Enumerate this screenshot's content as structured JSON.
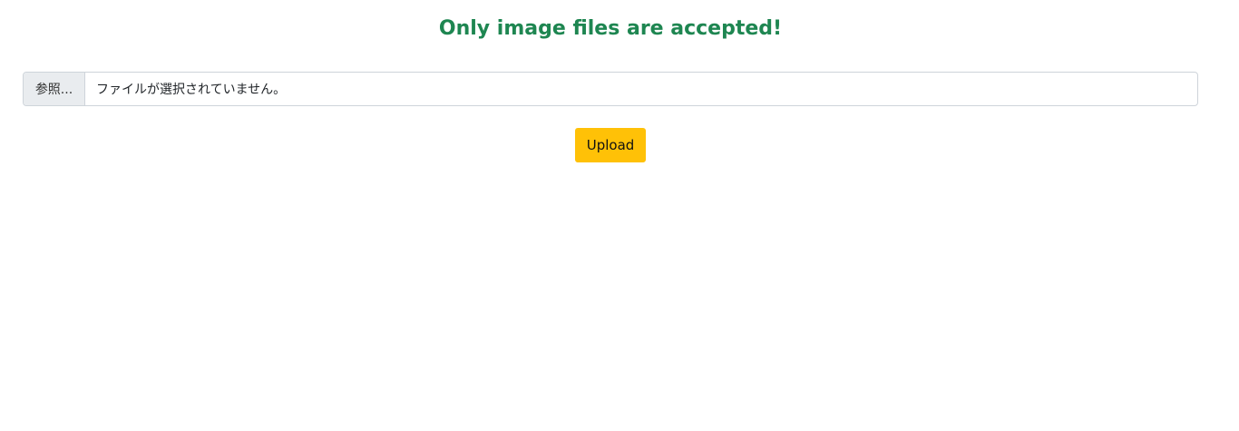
{
  "header": {
    "title": "Only image files are accepted!"
  },
  "file_input": {
    "browse_label": "参照...",
    "status_text": "ファイルが選択されていません。"
  },
  "upload_button": {
    "label": "Upload"
  },
  "colors": {
    "heading": "#1e8651",
    "upload_bg": "#ffc107",
    "input_border": "#ced4da",
    "browse_bg": "#e9ecef"
  }
}
